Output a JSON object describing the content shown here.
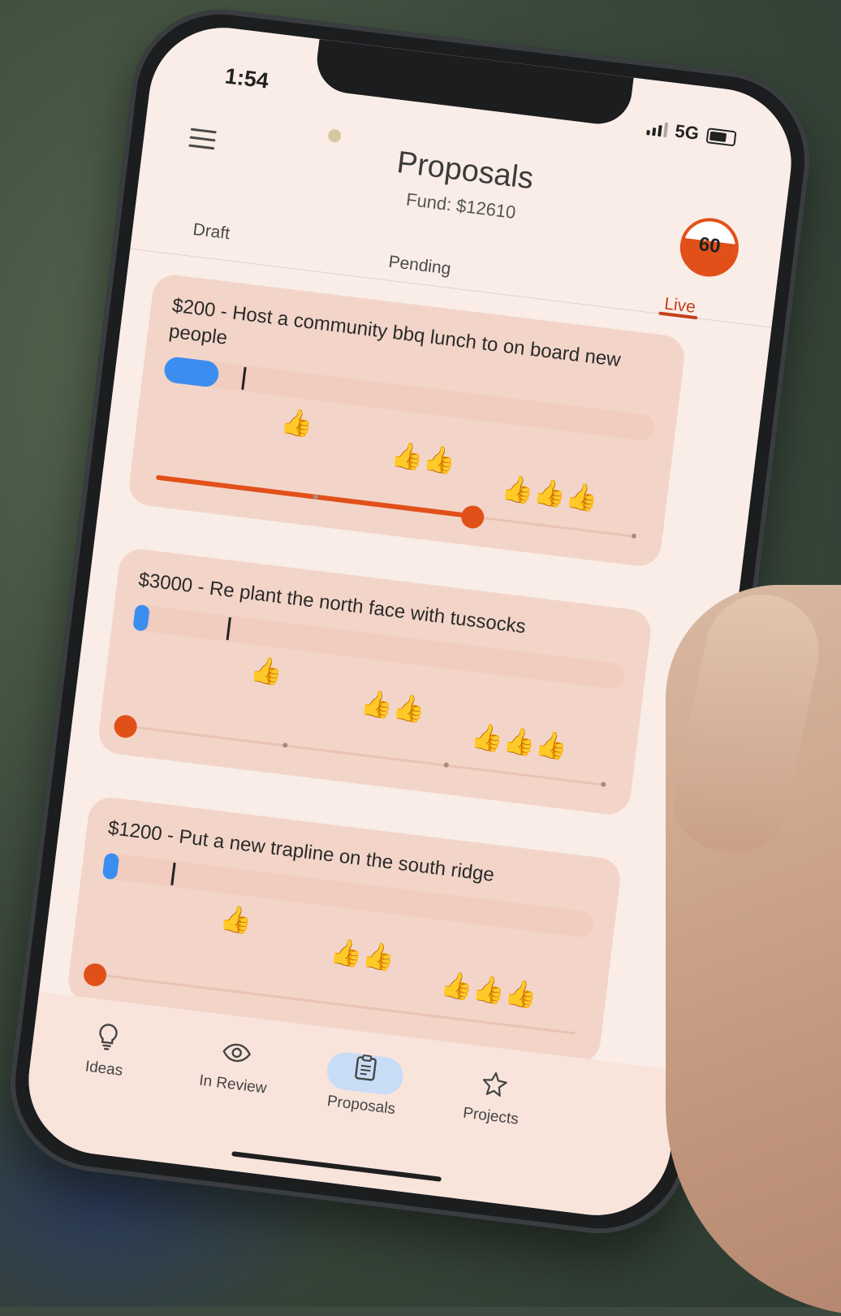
{
  "status_bar": {
    "time": "1:54",
    "network": "5G"
  },
  "header": {
    "title": "Proposals",
    "fund": "Fund: $12610",
    "score": "60"
  },
  "tabs": [
    {
      "label": "Draft",
      "active": false
    },
    {
      "label": "Pending",
      "active": false
    },
    {
      "label": "Live",
      "active": true
    }
  ],
  "colors": {
    "accent": "#e2501a",
    "progress": "#3b8ef0",
    "card": "#f2d5c8",
    "screen": "#faede8"
  },
  "thumb_levels": [
    "👍",
    "👍👍",
    "👍👍👍"
  ],
  "proposals": [
    {
      "title": "$200 - Host a community bbq lunch to on board new people",
      "progress": 0.11,
      "target": 0.16,
      "vote": 0.66
    },
    {
      "title": "$3000 - Re plant the north face with tussocks",
      "progress": 0.03,
      "target": 0.19,
      "vote": 0.0
    },
    {
      "title": "$1200 - Put a new trapline on the south ridge",
      "progress": 0.03,
      "target": 0.14,
      "vote": 0.0
    }
  ],
  "nav": [
    {
      "label": "Ideas",
      "icon": "lightbulb-icon"
    },
    {
      "label": "In Review",
      "icon": "eye-icon"
    },
    {
      "label": "Proposals",
      "icon": "clipboard-icon",
      "active": true
    },
    {
      "label": "Projects",
      "icon": "star-icon"
    }
  ]
}
